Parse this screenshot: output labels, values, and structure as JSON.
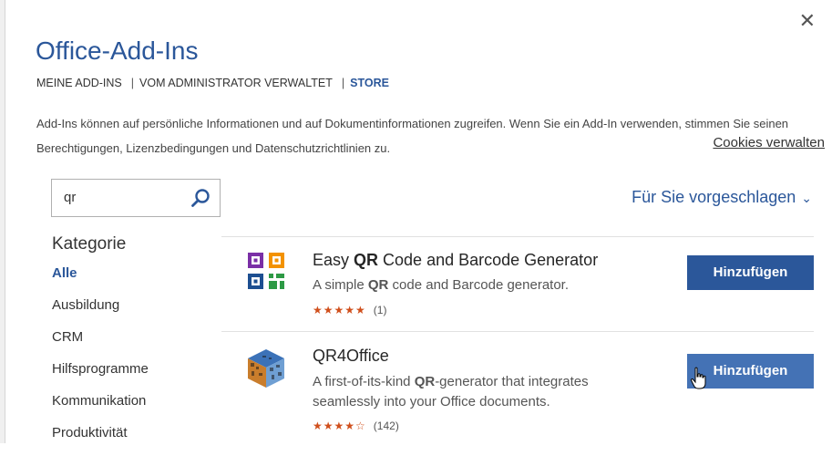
{
  "dialog": {
    "title": "Office-Add-Ins",
    "close_glyph": "✕"
  },
  "nav": {
    "my_addins": "MEINE ADD-INS",
    "admin_managed": "VOM ADMINISTRATOR VERWALTET",
    "store": "STORE",
    "separator": "|"
  },
  "info": {
    "text": "Add-Ins können auf persönliche Informationen und auf Dokumentinformationen zugreifen. Wenn Sie ein Add-In verwenden, stimmen Sie seinen Berechtigungen, Lizenzbedingungen und Datenschutzrichtlinien zu.",
    "cookies_link": "Cookies verwalten"
  },
  "search": {
    "value": "qr",
    "icon": "search-icon"
  },
  "categories": {
    "heading": "Kategorie",
    "items": [
      "Alle",
      "Ausbildung",
      "CRM",
      "Hilfsprogramme",
      "Kommunikation",
      "Produktivität"
    ]
  },
  "sort": {
    "label": "Für Sie vorgeschlagen",
    "chevron": "⌄"
  },
  "addins": [
    {
      "name_pre": "Easy ",
      "name_bold": "QR",
      "name_post": " Code and Barcode Generator",
      "desc_pre": "A simple ",
      "desc_bold": "QR",
      "desc_post": " code and Barcode generator.",
      "desc_line2": "",
      "rating_stars": "★★★★★",
      "rating": 5,
      "review_count": "(1)",
      "button": "Hinzufügen"
    },
    {
      "name_pre": "QR4Office",
      "name_bold": "",
      "name_post": "",
      "desc_pre": "A first-of-its-kind ",
      "desc_bold": "QR",
      "desc_post": "-generator that integrates",
      "desc_line2": "seamlessly into your Office documents.",
      "rating_stars": "★★★★☆",
      "rating": 4,
      "review_count": "(142)",
      "button": "Hinzufügen"
    }
  ],
  "colors": {
    "accent": "#2b579a",
    "button_hover": "#4472b5",
    "stars": "#d04f1c"
  }
}
